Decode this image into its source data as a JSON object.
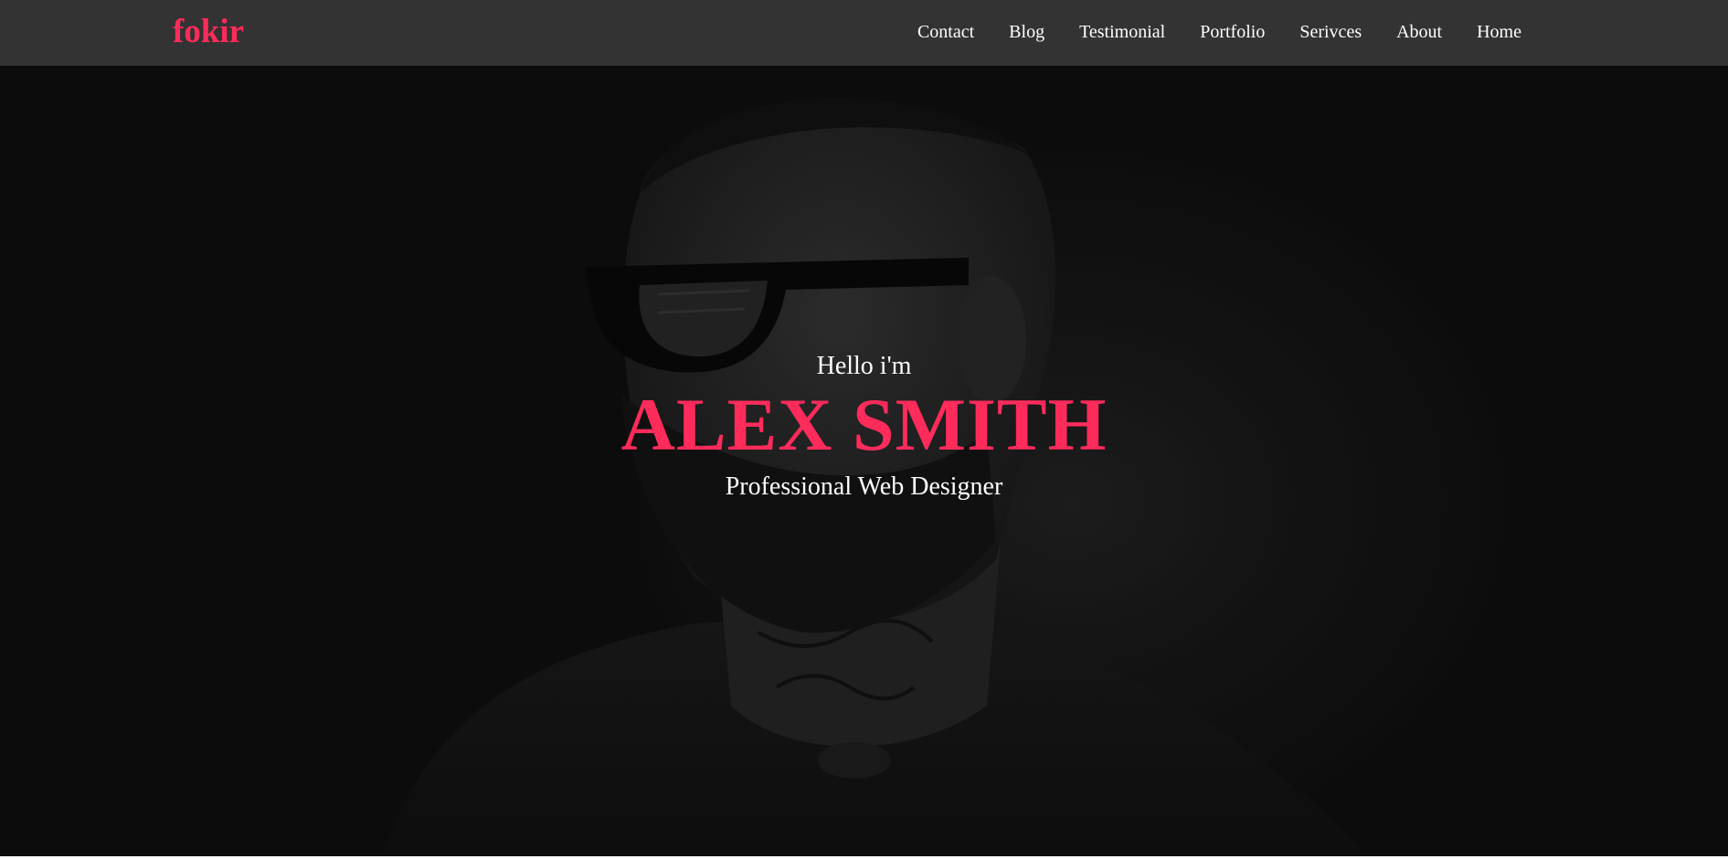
{
  "brand": {
    "logo_text": "fokir",
    "accent_color": "#ff2b5b"
  },
  "navbar": {
    "background": "#333333",
    "items": [
      {
        "label": "Contact"
      },
      {
        "label": "Blog"
      },
      {
        "label": "Testimonial"
      },
      {
        "label": "Portfolio"
      },
      {
        "label": "Serivces"
      },
      {
        "label": "About"
      },
      {
        "label": "Home"
      }
    ]
  },
  "hero": {
    "greeting": "Hello i'm",
    "name": "ALEX SMITH",
    "role": "Professional Web Designer",
    "background_image": "portrait-of-bearded-man-with-sunglasses-and-neck-tattoos"
  }
}
